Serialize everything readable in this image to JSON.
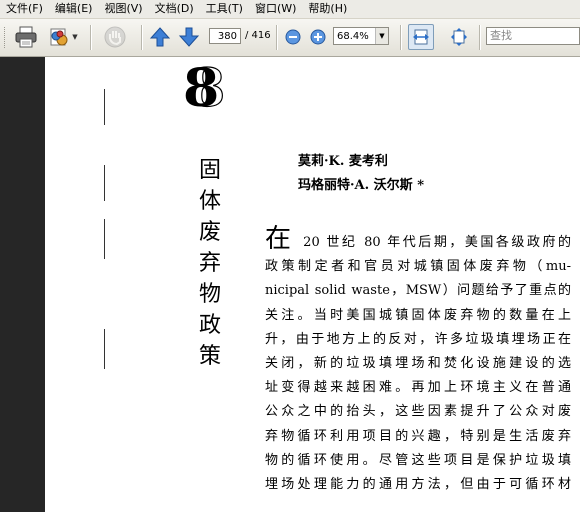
{
  "menu": [
    "文件(F)",
    "编辑(E)",
    "视图(V)",
    "文档(D)",
    "工具(T)",
    "窗口(W)",
    "帮助(H)"
  ],
  "toolbar": {
    "current_page": "380",
    "total_pages": "/ 416",
    "zoom": "68.4%",
    "search_placeholder": "查找",
    "icons": [
      "print-icon",
      "share-icon",
      "hand-icon",
      "prev-page-icon",
      "next-page-icon",
      "zoom-out-icon",
      "zoom-in-icon",
      "fit-width-icon",
      "fit-page-icon"
    ]
  },
  "document": {
    "chapter_number": "8",
    "title_chars": [
      "固",
      "体",
      "废",
      "弃",
      "物",
      "政",
      "策"
    ],
    "authors": [
      "莫莉·K. 麦考利",
      "玛格丽特·A. 沃尔斯 *"
    ],
    "drop_cap": "在",
    "body_lines": [
      " 20 世纪 80 年代后期，美国各级政府的",
      "政策制定者和官员对城镇固体废弃物（mu-",
      "nicipal solid waste，MSW）问题给予了重点的",
      "关注。当时美国城镇固体废弃物的数量在上",
      "升，由于地方上的反对，许多垃圾填埋场正在",
      "关闭，新的垃圾填埋场和焚化设施建设的选",
      "址变得越来越困难。再加上环境主义在普通",
      "公众之中的抬头，这些因素提升了公众对废",
      "弃物循环利用项目的兴趣，特别是生活废弃",
      "物的循环使用。尽管这些项目是保护垃圾填",
      "埋场处理能力的通用方法，但由于可循环材"
    ]
  }
}
